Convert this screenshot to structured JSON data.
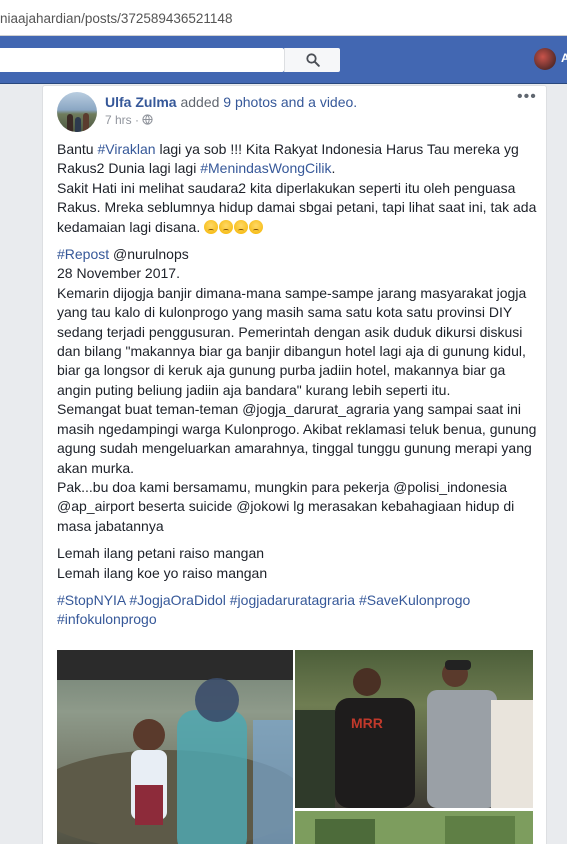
{
  "browser": {
    "url": "niaajahardian/posts/372589436521148"
  },
  "topbar": {
    "search_placeholder": "",
    "user_initial": "A"
  },
  "post": {
    "author": "Ulfa Zulma",
    "action_text": " added ",
    "media_link": "9 photos and a video.",
    "time": "7 hrs",
    "privacy_separator": " · ",
    "menu_label": "•••",
    "paragraphs": {
      "p1_before": "Bantu ",
      "p1_tag": "#Viraklan",
      "p1_mid": " lagi ya sob !!! Kita Rakyat Indonesia Harus Tau mereka yg Rakus2 Dunia lagi lagi ",
      "p1_tag2": "#MenindasWongCilik",
      "p1_after": ".",
      "p2": "Sakit Hati ini melihat saudara2 kita diperlakukan seperti itu oleh penguasa Rakus. Mreka seblumnya hidup damai sbgai petani, tapi lihat saat ini, tak ada kedamaian lagi disana. ",
      "repost_tag": "#Repost",
      "repost_user": " @nurulnops",
      "date": "28 November 2017.",
      "p3": "Kemarin dijogja banjir dimana-mana sampe-sampe jarang masyarakat jogja yang tau kalo di kulonprogo yang masih sama satu kota satu provinsi DIY sedang terjadi penggusuran. Pemerintah dengan asik duduk dikursi diskusi dan bilang \"makannya biar ga banjir dibangun hotel lagi aja di gunung kidul, biar ga longsor di keruk aja gunung purba jadiin hotel, makannya biar ga angin puting beliung jadiin aja bandara\" kurang lebih seperti itu.",
      "p4": "Semangat buat teman-teman @jogja_darurat_agraria yang sampai saat ini masih ngedampingi warga Kulonprogo. Akibat reklamasi teluk benua, gunung agung sudah mengeluarkan amarahnya, tinggal tunggu gunung merapi yang akan murka.",
      "p5": "Pak...bu doa kami bersamamu, mungkin para pekerja @polisi_indonesia @ap_airport beserta suicide @jokowi lg merasakan kebahagiaan hidup di masa jabatannya",
      "p6a": "Lemah ilang petani raiso mangan",
      "p6b": "Lemah ilang koe yo raiso mangan",
      "hashtags": "#StopNYIA #JogjaOraDidol #jogjadaruratagraria #SaveKulonprogo #infokulonprogo"
    }
  },
  "colors": {
    "facebook_blue": "#4267b2",
    "link": "#365899"
  }
}
